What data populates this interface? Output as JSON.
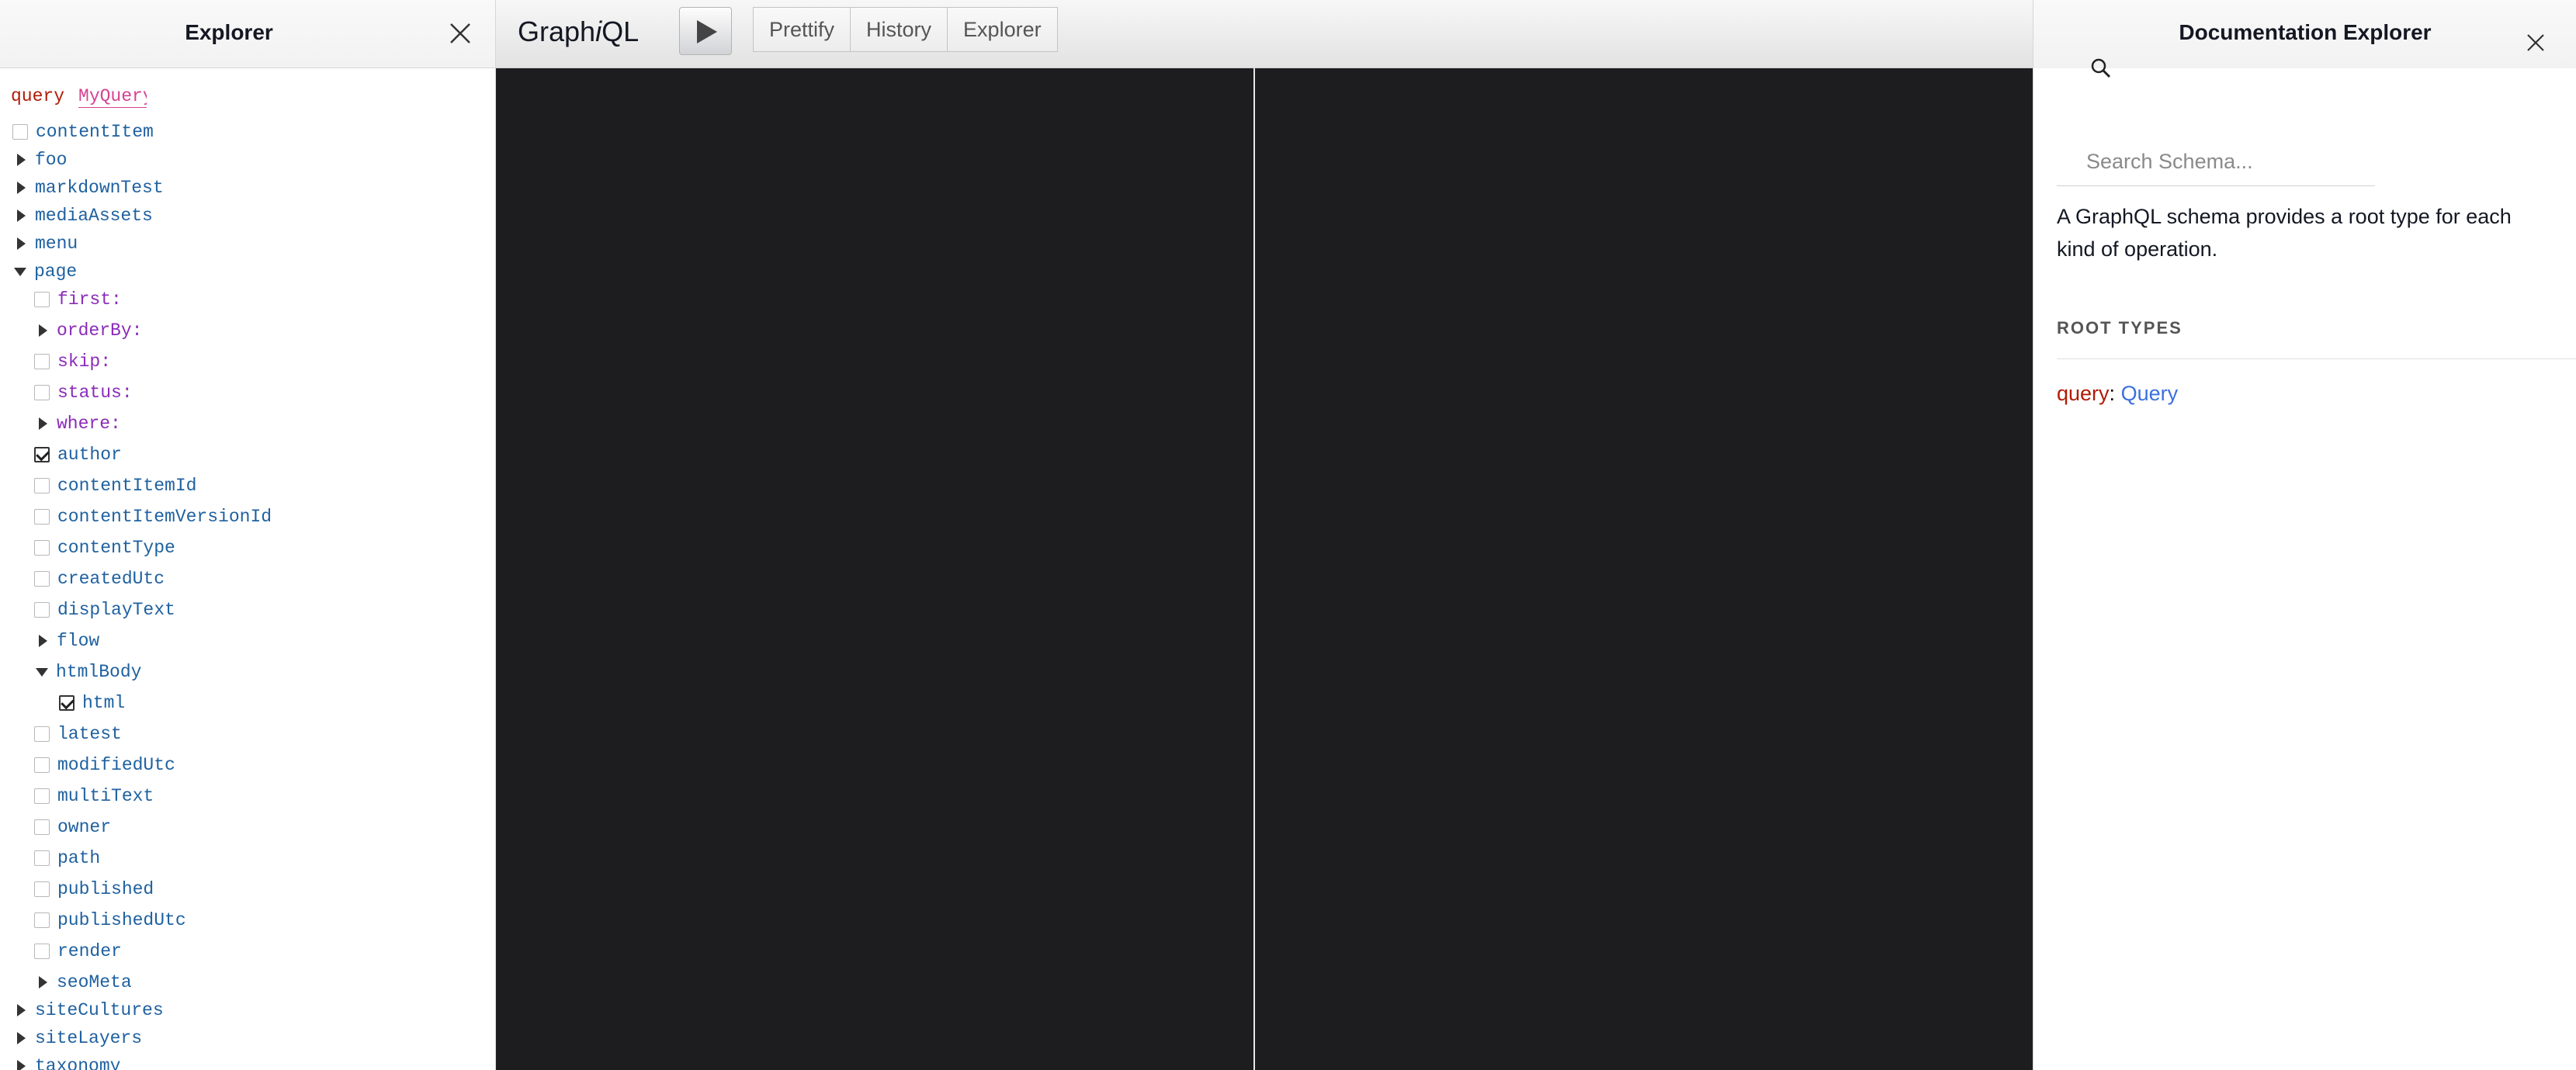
{
  "explorer": {
    "title": "Explorer",
    "operation_keyword": "query",
    "operation_name": "MyQuery",
    "tree": [
      {
        "label": "contentItem",
        "kind": "field",
        "control": "checkbox",
        "checked": false,
        "depth": 0
      },
      {
        "label": "foo",
        "kind": "field",
        "control": "collapsed",
        "depth": 0
      },
      {
        "label": "markdownTest",
        "kind": "field",
        "control": "collapsed",
        "depth": 0
      },
      {
        "label": "mediaAssets",
        "kind": "field",
        "control": "collapsed",
        "depth": 0
      },
      {
        "label": "menu",
        "kind": "field",
        "control": "collapsed",
        "depth": 0
      },
      {
        "label": "page",
        "kind": "field",
        "control": "expanded",
        "depth": 0
      },
      {
        "label": "first:",
        "kind": "arg",
        "control": "checkbox",
        "checked": false,
        "depth": 1
      },
      {
        "label": "orderBy:",
        "kind": "arg",
        "control": "collapsed",
        "depth": 1
      },
      {
        "label": "skip:",
        "kind": "arg",
        "control": "checkbox",
        "checked": false,
        "depth": 1
      },
      {
        "label": "status:",
        "kind": "arg",
        "control": "checkbox",
        "checked": false,
        "depth": 1
      },
      {
        "label": "where:",
        "kind": "arg",
        "control": "collapsed",
        "depth": 1
      },
      {
        "label": "author",
        "kind": "field",
        "control": "checkbox",
        "checked": true,
        "depth": 1
      },
      {
        "label": "contentItemId",
        "kind": "field",
        "control": "checkbox",
        "checked": false,
        "depth": 1
      },
      {
        "label": "contentItemVersionId",
        "kind": "field",
        "control": "checkbox",
        "checked": false,
        "depth": 1
      },
      {
        "label": "contentType",
        "kind": "field",
        "control": "checkbox",
        "checked": false,
        "depth": 1
      },
      {
        "label": "createdUtc",
        "kind": "field",
        "control": "checkbox",
        "checked": false,
        "depth": 1
      },
      {
        "label": "displayText",
        "kind": "field",
        "control": "checkbox",
        "checked": false,
        "depth": 1
      },
      {
        "label": "flow",
        "kind": "field",
        "control": "collapsed",
        "depth": 1
      },
      {
        "label": "htmlBody",
        "kind": "field",
        "control": "expanded",
        "depth": 1
      },
      {
        "label": "html",
        "kind": "field",
        "control": "checkbox",
        "checked": true,
        "depth": 2
      },
      {
        "label": "latest",
        "kind": "field",
        "control": "checkbox",
        "checked": false,
        "depth": 1
      },
      {
        "label": "modifiedUtc",
        "kind": "field",
        "control": "checkbox",
        "checked": false,
        "depth": 1
      },
      {
        "label": "multiText",
        "kind": "field",
        "control": "checkbox",
        "checked": false,
        "depth": 1
      },
      {
        "label": "owner",
        "kind": "field",
        "control": "checkbox",
        "checked": false,
        "depth": 1
      },
      {
        "label": "path",
        "kind": "field",
        "control": "checkbox",
        "checked": false,
        "depth": 1
      },
      {
        "label": "published",
        "kind": "field",
        "control": "checkbox",
        "checked": false,
        "depth": 1
      },
      {
        "label": "publishedUtc",
        "kind": "field",
        "control": "checkbox",
        "checked": false,
        "depth": 1
      },
      {
        "label": "render",
        "kind": "field",
        "control": "checkbox",
        "checked": false,
        "depth": 1
      },
      {
        "label": "seoMeta",
        "kind": "field",
        "control": "collapsed",
        "depth": 1
      },
      {
        "label": "siteCultures",
        "kind": "field",
        "control": "collapsed",
        "depth": 0
      },
      {
        "label": "siteLayers",
        "kind": "field",
        "control": "collapsed",
        "depth": 0
      },
      {
        "label": "taxonomy",
        "kind": "field",
        "control": "collapsed",
        "depth": 0
      }
    ]
  },
  "toolbar": {
    "logo_prefix": "Graph",
    "logo_italic": "i",
    "logo_suffix": "QL",
    "prettify_label": "Prettify",
    "history_label": "History",
    "explorer_label": "Explorer"
  },
  "docs": {
    "title": "Documentation Explorer",
    "search_placeholder": "Search Schema...",
    "description": "A GraphQL schema provides a root type for each kind of operation.",
    "root_types_heading": "ROOT TYPES",
    "root_query_keyword": "query",
    "root_query_sep": ": ",
    "root_query_type": "Query"
  },
  "colors": {
    "editor_bg": "#1d1d20",
    "field": "#1f61a0",
    "arg": "#8b2bb9",
    "keyword": "#b11a04",
    "type_link": "#3b6fe0"
  }
}
